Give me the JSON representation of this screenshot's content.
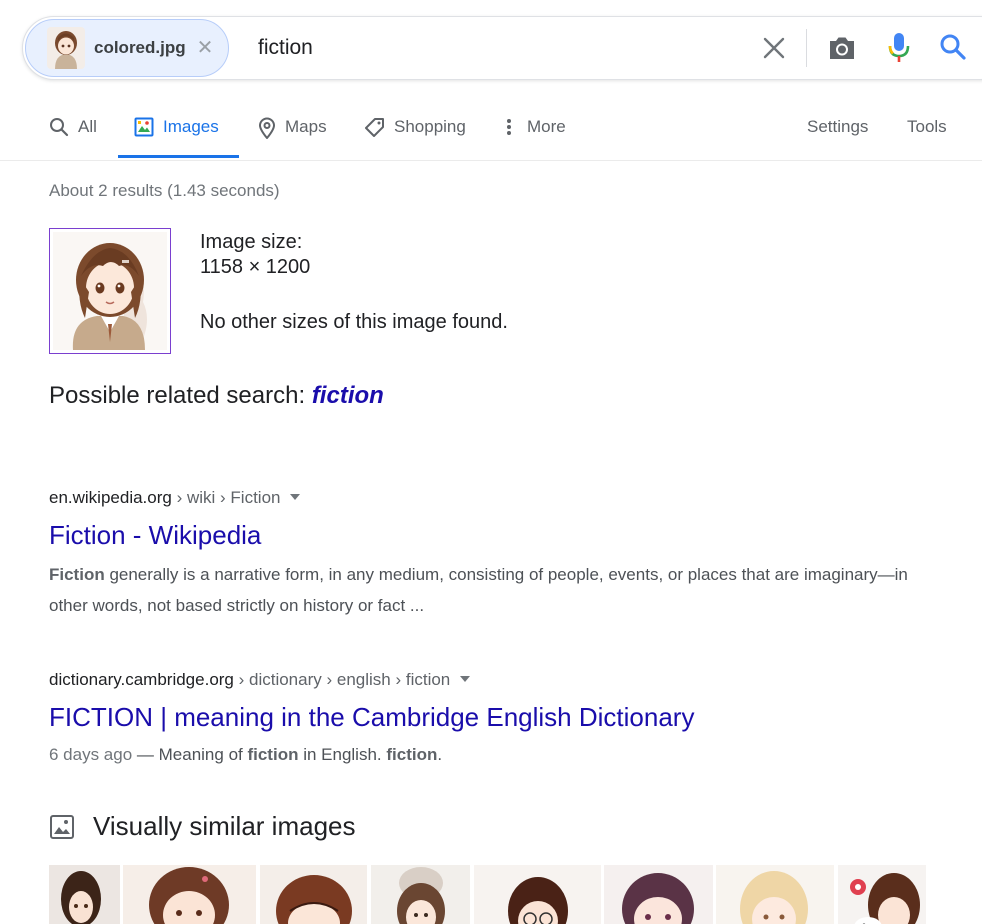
{
  "search": {
    "chip_label": "colored.jpg",
    "query": "fiction"
  },
  "tabs": [
    {
      "label": "All",
      "icon": "search-icon"
    },
    {
      "label": "Images",
      "icon": "images-icon",
      "active": true
    },
    {
      "label": "Maps",
      "icon": "map-pin-icon"
    },
    {
      "label": "Shopping",
      "icon": "tag-icon"
    },
    {
      "label": "More",
      "icon": "more-vert-icon"
    },
    {
      "label": "Settings"
    },
    {
      "label": "Tools"
    }
  ],
  "stats": "About 2 results (1.43 seconds)",
  "image_info": {
    "size_label": "Image size:",
    "size_value": "1158 × 1200",
    "no_other": "No other sizes of this image found."
  },
  "related": {
    "prefix": "Possible related search:",
    "term": "fiction"
  },
  "results": [
    {
      "domain": "en.wikipedia.org",
      "path": " › wiki › Fiction",
      "title": "Fiction - Wikipedia",
      "snippet_bold": "Fiction",
      "snippet_rest": " generally is a narrative form, in any medium, consisting of people, events, or places that are imaginary—in other words, not based strictly on history or fact ..."
    },
    {
      "domain": "dictionary.cambridge.org",
      "path": " › dictionary › english › fiction",
      "title": "FICTION | meaning in the Cambridge English Dictionary",
      "date": "6 days ago",
      "snippet_pre": " — Meaning of ",
      "snippet_b1": "fiction",
      "snippet_mid": " in English. ",
      "snippet_b2": "fiction",
      "snippet_end": "."
    }
  ],
  "similar": {
    "heading": "Visually similar images"
  },
  "colors": {
    "accent": "#1a73e8",
    "link": "#1a0dab",
    "chip_bg": "#e8f0fe"
  }
}
